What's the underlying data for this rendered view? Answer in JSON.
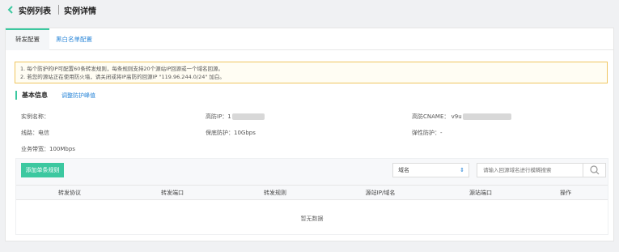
{
  "header": {
    "back_icon": "chevron-left-icon",
    "breadcrumb_list": "实例列表",
    "breadcrumb_detail": "实例详情",
    "accent": "#3cc8a0"
  },
  "tabs": [
    {
      "label": "转发配置",
      "active": true
    },
    {
      "label": "黑白名单配置",
      "active": false
    }
  ],
  "notice": {
    "line1": "1. 每个防护的IP可配置60条转发规则，每条规则支持20个源站IP回源或一个域名回源。",
    "line2": "2. 若您的源站正在使用防火墙，请关闭或将IP高防的回源IP \"119.96.244.0/24\" 加白。"
  },
  "basic_info": {
    "title": "基本信息",
    "link": "调整防护峰值",
    "instance_name": "实例名称：",
    "high_defense_ip": "高防IP：1",
    "cname": "高防CNAME： v9u",
    "line": "线路：电信",
    "guaranteed_protection": "保底防护：10Gbps",
    "elastic_protection": "弹性防护：-",
    "bandwidth": "业务带宽：100Mbps"
  },
  "toolbar": {
    "add_rule": "添加单条规则",
    "select_value": "域名",
    "search_placeholder": "请输入回源域名进行模糊搜索",
    "search_icon": "search-icon"
  },
  "table": {
    "columns": [
      "转发协议",
      "转发端口",
      "转发规则",
      "源站IP/域名",
      "源站端口",
      "操作"
    ],
    "empty_text": "暂无数据"
  }
}
